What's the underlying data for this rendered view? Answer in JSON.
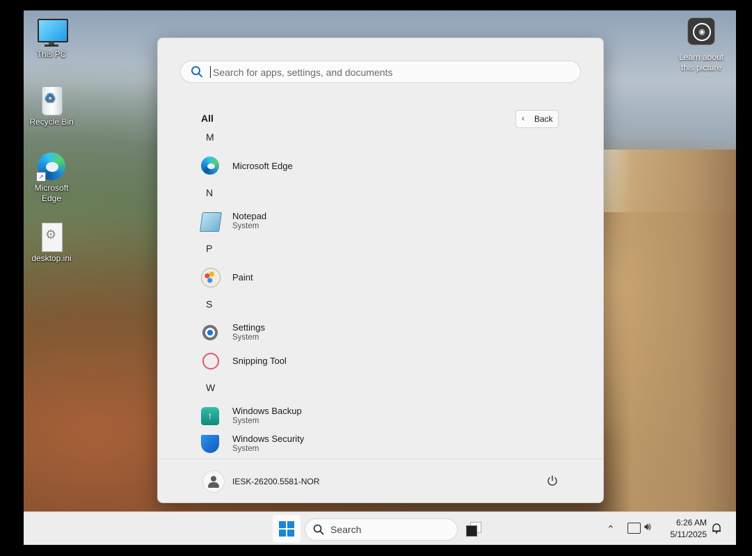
{
  "desktop": {
    "icons": [
      {
        "label": "This PC"
      },
      {
        "label": "Recycle Bin"
      },
      {
        "label": "Microsoft Edge"
      },
      {
        "label": "desktop.ini"
      }
    ],
    "learn_label": "Learn about this picture"
  },
  "start_menu": {
    "search_placeholder": "Search for apps, settings, and documents",
    "all_label": "All",
    "back_label": "Back",
    "groups": [
      {
        "letter": "M",
        "apps": [
          {
            "name": "Microsoft Edge",
            "sub": ""
          }
        ]
      },
      {
        "letter": "N",
        "apps": [
          {
            "name": "Notepad",
            "sub": "System"
          }
        ]
      },
      {
        "letter": "P",
        "apps": [
          {
            "name": "Paint",
            "sub": ""
          }
        ]
      },
      {
        "letter": "S",
        "apps": [
          {
            "name": "Settings",
            "sub": "System"
          },
          {
            "name": "Snipping Tool",
            "sub": ""
          }
        ]
      },
      {
        "letter": "W",
        "apps": [
          {
            "name": "Windows Backup",
            "sub": "System"
          },
          {
            "name": "Windows Security",
            "sub": "System"
          }
        ]
      }
    ],
    "user_name": "IESK-26200.5581-NOR"
  },
  "taskbar": {
    "search_label": "Search",
    "time": "6:26 AM",
    "date": "5/11/2025"
  },
  "colors": {
    "accent": "#1a86d9",
    "menu_bg": "#eeeeee",
    "taskbar_bg": "#ededed"
  }
}
